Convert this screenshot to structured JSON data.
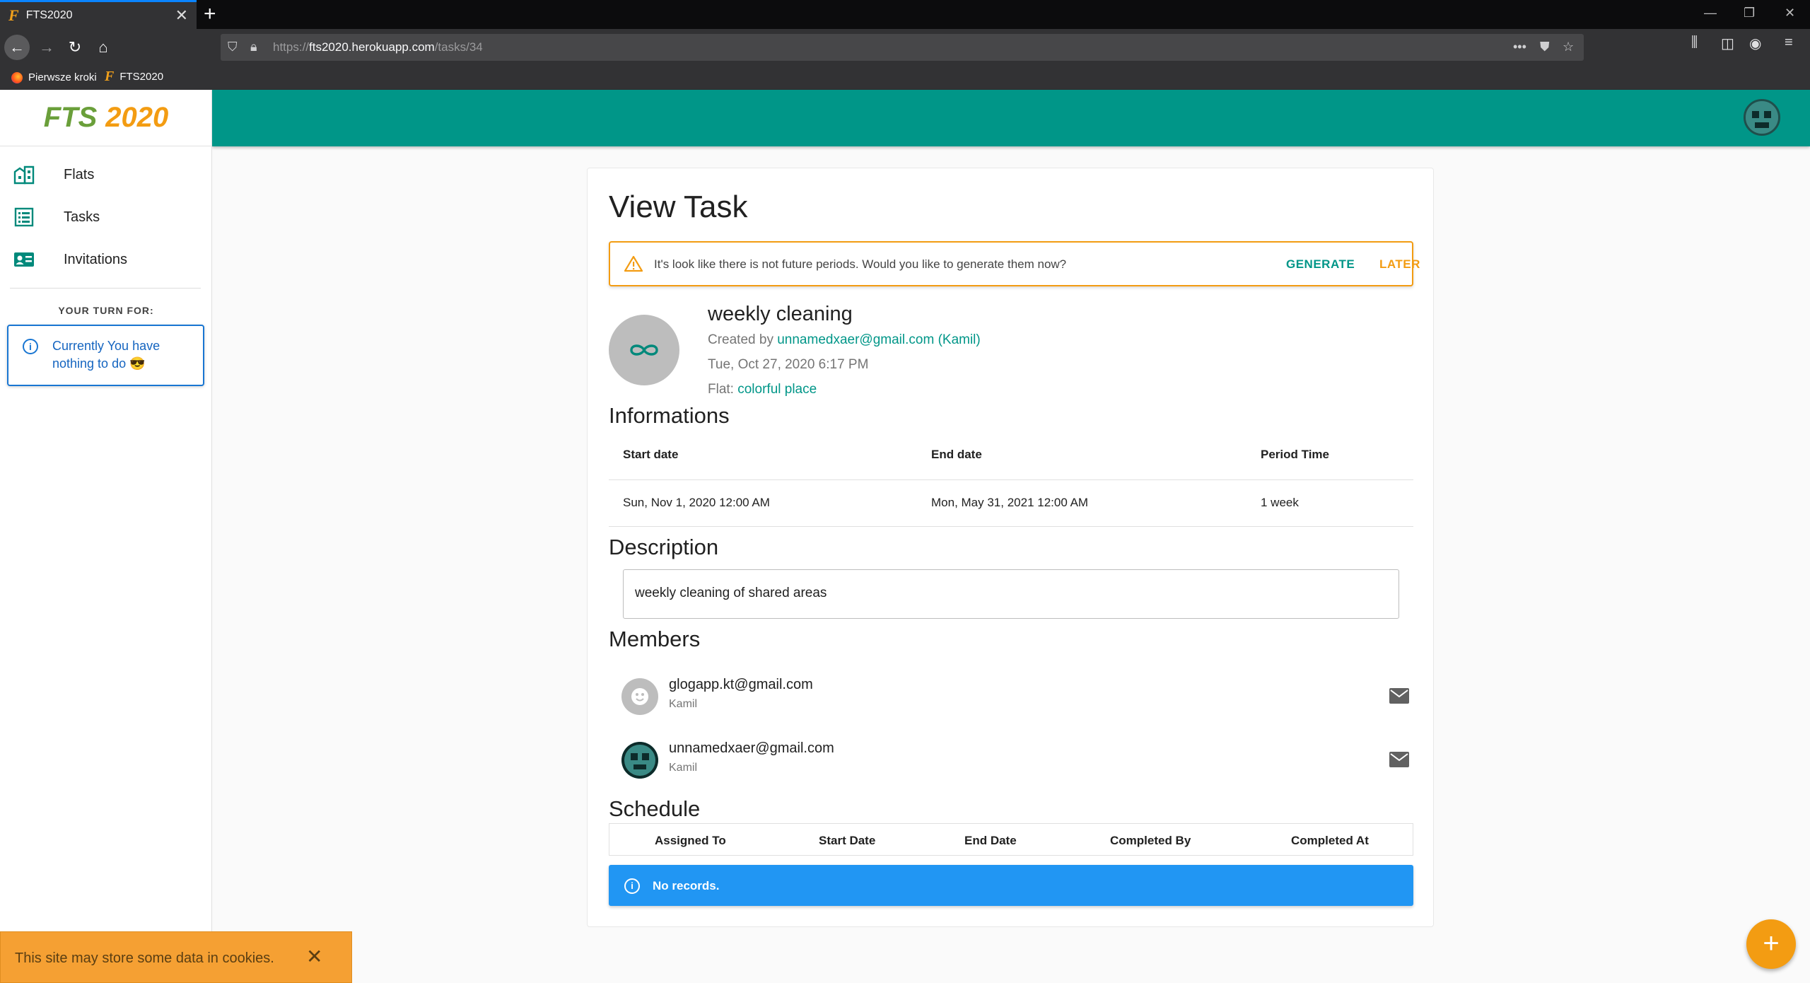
{
  "browser": {
    "tab_title": "FTS2020",
    "tab_favicon": "F",
    "url_scheme": "https://",
    "url_host": "fts2020.herokuapp.com",
    "url_path": "/tasks/34",
    "bookmarks": [
      {
        "label": "Pierwsze kroki"
      },
      {
        "label": "FTS2020"
      }
    ]
  },
  "app": {
    "logo_part1": "FTS",
    "logo_part2": "2020",
    "brand_color": "#009688",
    "accent_color": "#f39c12"
  },
  "sidebar": {
    "items": [
      {
        "label": "Flats",
        "icon": "building-icon"
      },
      {
        "label": "Tasks",
        "icon": "list-icon"
      },
      {
        "label": "Invitations",
        "icon": "id-card-icon"
      }
    ],
    "turn_label": "YOUR TURN FOR:",
    "turn_message": "Currently You have nothing to do 😎"
  },
  "page": {
    "title": "View Task",
    "alert": {
      "text": "It's look like there is not future periods. Would you like to generate them now?",
      "generate_label": "GENERATE",
      "later_label": "LATER"
    },
    "task": {
      "name": "weekly cleaning",
      "created_by_prefix": "Created by",
      "created_by_link": "unnamedxaer@gmail.com (Kamil)",
      "created_at": "Tue, Oct 27, 2020 6:17 PM",
      "flat_prefix": "Flat:",
      "flat_link": "colorful place"
    },
    "informations": {
      "heading": "Informations",
      "headers": [
        "Start date",
        "End date",
        "Period Time"
      ],
      "values": [
        "Sun, Nov 1, 2020 12:00 AM",
        "Mon, May 31, 2021 12:00 AM",
        "1 week"
      ]
    },
    "description": {
      "heading": "Description",
      "text": "weekly cleaning of shared areas"
    },
    "members": {
      "heading": "Members",
      "list": [
        {
          "email": "glogapp.kt@gmail.com",
          "name": "Kamil"
        },
        {
          "email": "unnamedxaer@gmail.com",
          "name": "Kamil"
        }
      ]
    },
    "schedule": {
      "heading": "Schedule",
      "headers": [
        "Assigned To",
        "Start Date",
        "End Date",
        "Completed By",
        "Completed At"
      ],
      "empty_message": "No records."
    }
  },
  "cookie": {
    "text": "This site may store some data in cookies."
  },
  "fab_label": "+"
}
